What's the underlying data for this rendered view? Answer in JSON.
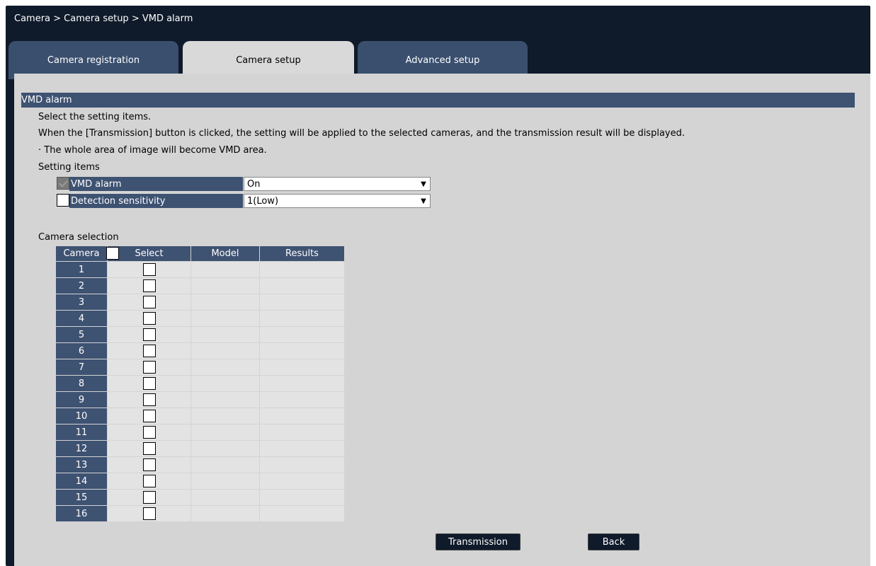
{
  "breadcrumb": "Camera > Camera setup > VMD alarm",
  "tabs": [
    {
      "label": "Camera registration",
      "active": false
    },
    {
      "label": "Camera setup",
      "active": true
    },
    {
      "label": "Advanced setup",
      "active": false
    }
  ],
  "section": {
    "title": "VMD alarm"
  },
  "instructions": {
    "line1": "Select the setting items.",
    "line2": "When the [Transmission]  button is clicked, the setting will be applied to the selected cameras, and the transmission result will be displayed.",
    "line3": "· The whole area of image will become VMD area."
  },
  "setting_items": {
    "label": "Setting items",
    "items": [
      {
        "name": "VMD alarm",
        "value": "On",
        "checkbox": "disabled-checked"
      },
      {
        "name": "Detection sensitivity",
        "value": "1(Low)",
        "checkbox": "unchecked"
      }
    ]
  },
  "camera_selection": {
    "label": "Camera selection",
    "headers": {
      "camera": "Camera",
      "select": "Select",
      "model": "Model",
      "results": "Results"
    },
    "rows": [
      "1",
      "2",
      "3",
      "4",
      "5",
      "6",
      "7",
      "8",
      "9",
      "10",
      "11",
      "12",
      "13",
      "14",
      "15",
      "16"
    ]
  },
  "buttons": {
    "transmission": "Transmission",
    "back": "Back"
  },
  "icons": {
    "dropdown": "chevron-down-icon"
  },
  "colors": {
    "frame": "#0f1a2a",
    "header_blue": "#3e5272",
    "tab_inactive": "#3a4f6e",
    "panel": "#d4d4d4"
  }
}
